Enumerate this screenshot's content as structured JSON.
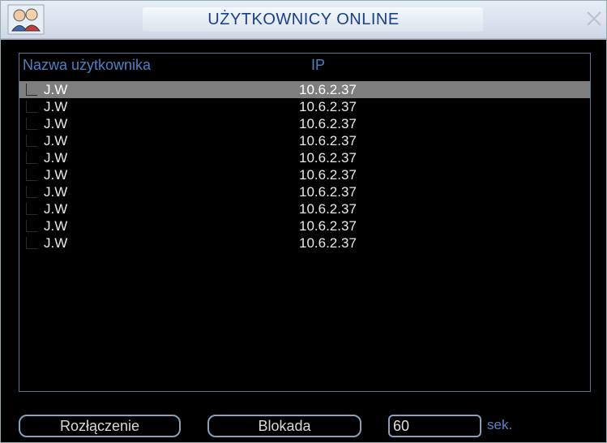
{
  "window": {
    "title": "UŻYTKOWNICY ONLINE",
    "icons": {
      "left": "users-icon",
      "close": "close-icon"
    }
  },
  "list": {
    "columns": {
      "name": "Nazwa użytkownika",
      "ip": "IP"
    },
    "rows": [
      {
        "name": "J.W",
        "ip": "10.6.2.37",
        "selected": true
      },
      {
        "name": "J.W",
        "ip": "10.6.2.37"
      },
      {
        "name": "J.W",
        "ip": "10.6.2.37"
      },
      {
        "name": "J.W",
        "ip": "10.6.2.37"
      },
      {
        "name": "J.W",
        "ip": "10.6.2.37"
      },
      {
        "name": "J.W",
        "ip": "10.6.2.37"
      },
      {
        "name": "J.W",
        "ip": "10.6.2.37"
      },
      {
        "name": "J.W",
        "ip": "10.6.2.37"
      },
      {
        "name": "J.W",
        "ip": "10.6.2.37"
      },
      {
        "name": "J.W",
        "ip": "10.6.2.37"
      }
    ]
  },
  "footer": {
    "disconnect_label": "Rozłączenie",
    "block_label": "Blokada",
    "duration_value": "60",
    "unit_label": "sek."
  },
  "colors": {
    "title_text": "#1a3f8f",
    "header_text": "#4f80c0",
    "selected_row": "#7e7e7e"
  }
}
